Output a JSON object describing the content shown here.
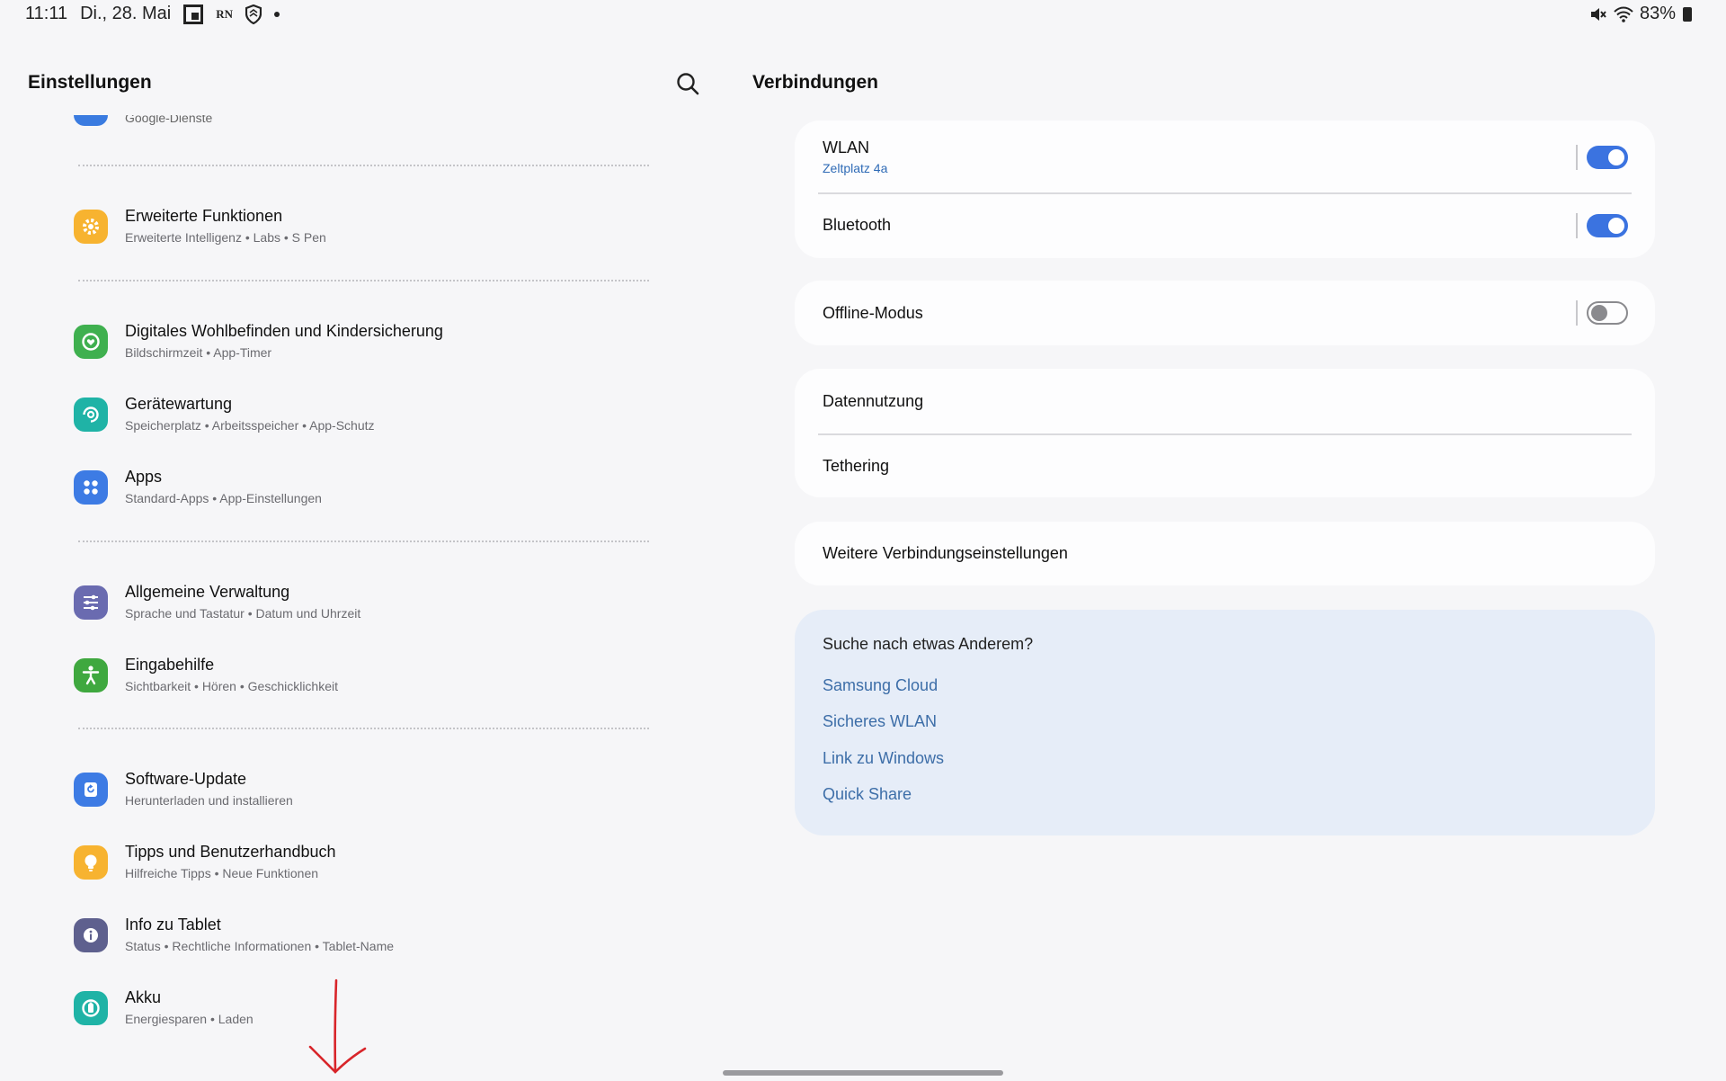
{
  "status_bar": {
    "time": "11:11",
    "date": "Di., 28. Mai",
    "rn_label": "RN",
    "battery": "83%"
  },
  "left_panel": {
    "title": "Einstellungen",
    "cut_item_label": "Google-Dienste",
    "items": [
      {
        "title": "Erweiterte Funktionen",
        "subtitle": "Erweiterte Intelligenz  •  Labs  •  S Pen",
        "icon": "gear-icon",
        "color": "#f7b330"
      },
      {
        "title": "Digitales Wohlbefinden und Kindersicherung",
        "subtitle": "Bildschirmzeit  •  App-Timer",
        "icon": "wellbeing-icon",
        "color": "#3fb04f"
      },
      {
        "title": "Gerätewartung",
        "subtitle": "Speicherplatz  •  Arbeitsspeicher  •  App-Schutz",
        "icon": "device-care-icon",
        "color": "#1fb3a6"
      },
      {
        "title": "Apps",
        "subtitle": "Standard-Apps  •  App-Einstellungen",
        "icon": "apps-icon",
        "color": "#3d7be4"
      },
      {
        "title": "Allgemeine Verwaltung",
        "subtitle": "Sprache und Tastatur  •  Datum und Uhrzeit",
        "icon": "sliders-icon",
        "color": "#6a6bb0"
      },
      {
        "title": "Eingabehilfe",
        "subtitle": "Sichtbarkeit  •  Hören  •  Geschicklichkeit",
        "icon": "accessibility-icon",
        "color": "#3fa83f"
      },
      {
        "title": "Software-Update",
        "subtitle": "Herunterladen und installieren",
        "icon": "software-update-icon",
        "color": "#3d7be4"
      },
      {
        "title": "Tipps und Benutzerhandbuch",
        "subtitle": "Hilfreiche Tipps  •  Neue Funktionen",
        "icon": "lightbulb-icon",
        "color": "#f7b330"
      },
      {
        "title": "Info zu Tablet",
        "subtitle": "Status  •  Rechtliche Informationen  •  Tablet-Name",
        "icon": "info-icon",
        "color": "#5e608e"
      },
      {
        "title": "Akku",
        "subtitle": "Energiesparen  •  Laden",
        "icon": "battery-icon",
        "color": "#1fb3a6"
      }
    ]
  },
  "right_panel": {
    "title": "Verbindungen",
    "wlan": {
      "title": "WLAN",
      "subtitle": "Zeltplatz 4a",
      "enabled": true
    },
    "bluetooth": {
      "title": "Bluetooth",
      "enabled": true
    },
    "offline": {
      "title": "Offline-Modus",
      "enabled": false
    },
    "data_usage": "Datennutzung",
    "tethering": "Tethering",
    "more": "Weitere Verbindungseinstellungen",
    "suggestions": {
      "title": "Suche nach etwas Anderem?",
      "links": [
        "Samsung Cloud",
        "Sicheres WLAN",
        "Link zu Windows",
        "Quick Share"
      ]
    }
  },
  "colors": {
    "accent": "#3b73e0",
    "link": "#3d6ea8",
    "background": "#f6f6f8",
    "annotation_arrow": "#d8252a"
  }
}
